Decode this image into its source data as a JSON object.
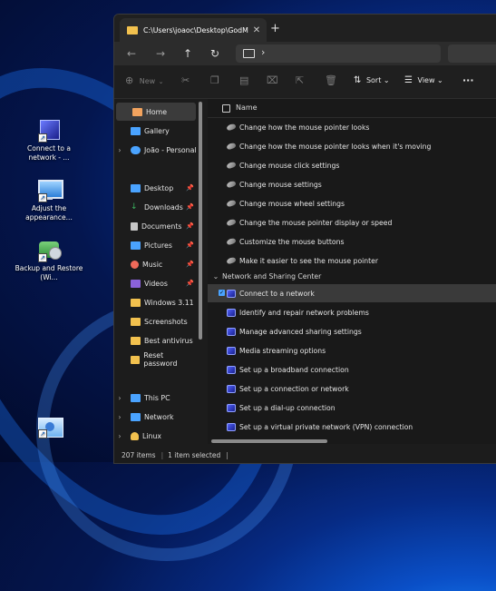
{
  "desktop": {
    "icons": [
      {
        "label": "Connect to a network - ...",
        "icon": "network-icon"
      },
      {
        "label": "Adjust the appearance...",
        "icon": "display-settings-icon"
      },
      {
        "label": "Backup and Restore (Wi...",
        "icon": "backup-icon"
      },
      {
        "label": "",
        "icon": "control-panel-icon"
      }
    ]
  },
  "window": {
    "tab_title": "C:\\Users\\joaoc\\Desktop\\GodM",
    "tab_close": "✕",
    "new_tab": "+",
    "nav": {
      "back": "←",
      "forward": "→",
      "up": "↑",
      "refresh": "↻",
      "chevron": "›"
    },
    "command_bar": {
      "new_label": "New",
      "sort_label": "Sort",
      "view_label": "View",
      "more": "···"
    },
    "sidebar": {
      "items": [
        {
          "label": "Home",
          "icon": "home-icon",
          "color": "#f2a35e"
        },
        {
          "label": "Gallery",
          "icon": "gallery-icon",
          "color": "#4aa3ff"
        },
        {
          "label": "João - Personal",
          "icon": "onedrive-icon",
          "color": "#4aa3ff"
        },
        {
          "label": "Desktop",
          "icon": "desktop-folder-icon",
          "color": "#4aa3ff"
        },
        {
          "label": "Downloads",
          "icon": "download-icon",
          "color": "#3bb35e"
        },
        {
          "label": "Documents",
          "icon": "documents-icon",
          "color": "#c7c7c7"
        },
        {
          "label": "Pictures",
          "icon": "pictures-icon",
          "color": "#4aa3ff"
        },
        {
          "label": "Music",
          "icon": "music-icon",
          "color": "#f06a5a"
        },
        {
          "label": "Videos",
          "icon": "videos-icon",
          "color": "#8b62d9"
        },
        {
          "label": "Windows 3.11",
          "icon": "folder-icon",
          "color": "#f2c14e"
        },
        {
          "label": "Screenshots",
          "icon": "folder-icon",
          "color": "#f2c14e"
        },
        {
          "label": "Best antivirus",
          "icon": "folder-icon",
          "color": "#f2c14e"
        },
        {
          "label": "Reset password",
          "icon": "folder-icon",
          "color": "#f2c14e"
        },
        {
          "label": "This PC",
          "icon": "this-pc-icon",
          "color": "#4aa3ff"
        },
        {
          "label": "Network",
          "icon": "network-icon",
          "color": "#4aa3ff"
        },
        {
          "label": "Linux",
          "icon": "linux-icon",
          "color": "#f2c14e"
        }
      ]
    },
    "content": {
      "column_name": "Name",
      "mouse_rows": [
        "Change how the mouse pointer looks",
        "Change how the mouse pointer looks when it's moving",
        "Change mouse click settings",
        "Change mouse settings",
        "Change mouse wheel settings",
        "Change the mouse pointer display or speed",
        "Customize the mouse buttons",
        "Make it easier to see the mouse pointer"
      ],
      "group_label": "Network and Sharing Center",
      "network_rows": [
        "Connect to a network",
        "Identify and repair network problems",
        "Manage advanced sharing settings",
        "Media streaming options",
        "Set up a broadband connection",
        "Set up a connection or network",
        "Set up a dial-up connection",
        "Set up a virtual private network (VPN) connection"
      ]
    },
    "status": {
      "items": "207 items",
      "selected": "1 item selected"
    }
  }
}
